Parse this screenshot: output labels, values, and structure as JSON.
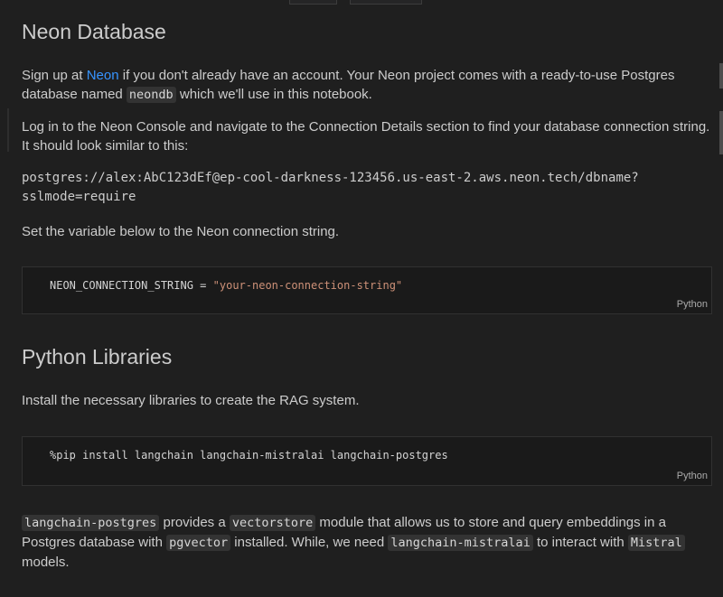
{
  "neon_section": {
    "heading": "Neon Database",
    "p1": {
      "pre": "Sign up at ",
      "link": "Neon",
      "mid": " if you don't already have an account. Your Neon project comes with a ready-to-use Postgres database named ",
      "code": "neondb",
      "post": " which we'll use in this notebook."
    },
    "p2": "Log in to the Neon Console and navigate to the Connection Details section to find your database connection string. It should look similar to this:",
    "connection_example_line1": "postgres://alex:AbC123dEf@ep-cool-darkness-123456.us-east-2.aws.neon.tech/dbname?",
    "connection_example_line2": "sslmode=require",
    "p3": "Set the variable below to the Neon connection string."
  },
  "code_cell_1": {
    "variable": "NEON_CONNECTION_STRING",
    "operator": " = ",
    "value": "\"your-neon-connection-string\"",
    "language": "Python"
  },
  "libraries_section": {
    "heading": "Python Libraries",
    "p1": "Install the necessary libraries to create the RAG system."
  },
  "code_cell_2": {
    "code": "%pip install langchain langchain-mistralai langchain-postgres",
    "language": "Python"
  },
  "final_paragraph": {
    "code1": "langchain-postgres",
    "text1": " provides a ",
    "code2": "vectorstore",
    "text2": " module that allows us to store and query embeddings in a Postgres database with ",
    "code3": "pgvector",
    "text3": " installed. While, we need ",
    "code4": "langchain-mistralai",
    "text4": " to interact with ",
    "code5": "Mistral",
    "text5": " models."
  }
}
